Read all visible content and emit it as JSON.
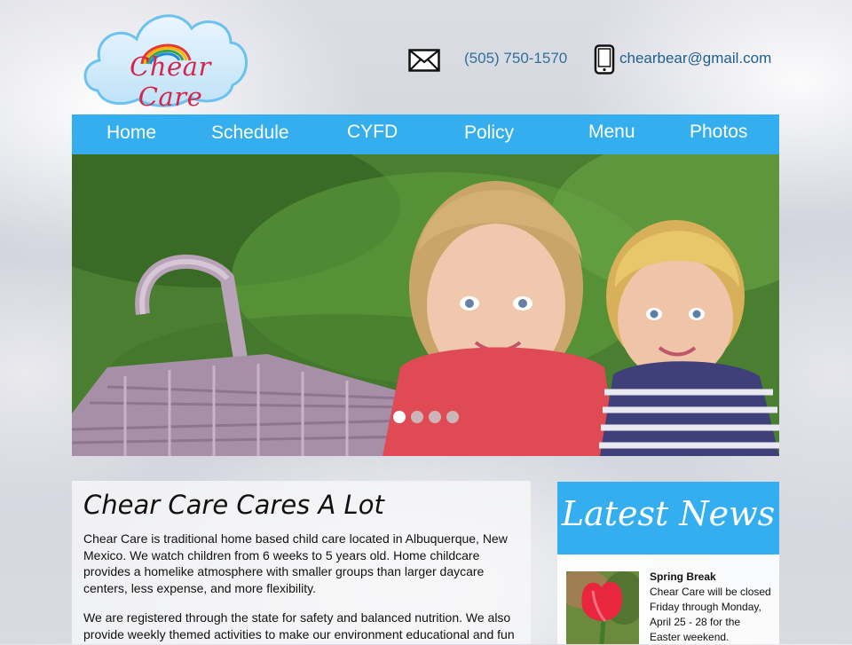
{
  "logo": {
    "text": "Chear Care"
  },
  "contact": {
    "mail_icon": "envelope-icon",
    "phone": "(505) 750-1570",
    "phone_icon": "mobile-phone-icon",
    "email": "chearbear@gmail.com"
  },
  "nav": {
    "items": [
      {
        "label": "Home"
      },
      {
        "label": "Schedule"
      },
      {
        "label": "CYFD"
      },
      {
        "label": "Policy"
      },
      {
        "label": "Menu"
      },
      {
        "label": "Photos"
      }
    ]
  },
  "slider": {
    "slide_count": 4,
    "active_index": 0
  },
  "main": {
    "title": "Chear Care Cares A Lot",
    "paragraphs": [
      "Chear Care is traditional home based child care  located in Albuquerque, New Mexico. We watch children from 6 weeks to 5 years old. Home childcare provides a homelike atmosphere with smaller groups than larger daycare centers, less expense, and more flexibility.",
      "We are registered through the state for safety and balanced nutrition. We also provide weekly themed activities to make our environment educational and fun"
    ]
  },
  "news": {
    "title": "Latest News",
    "items": [
      {
        "headline": "Spring Break",
        "text": "Chear Care will be closed Friday through Monday, April 25 - 28  for the Easter weekend."
      }
    ]
  },
  "colors": {
    "accent": "#35aef0",
    "logo_text": "#d6254b",
    "contact_text": "#2f6f9a"
  }
}
